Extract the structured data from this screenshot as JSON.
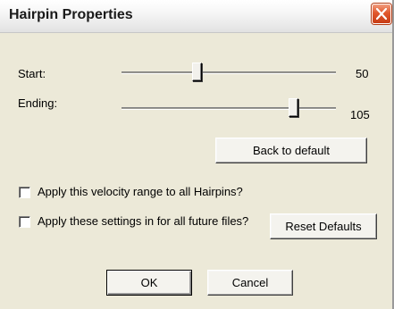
{
  "window": {
    "title": "Hairpin Properties"
  },
  "start": {
    "label": "Start:",
    "value": "50",
    "level": 0.35
  },
  "ending": {
    "label": "Ending:",
    "value": "105",
    "level": 0.8
  },
  "buttons": {
    "back_to_default": "Back to default",
    "reset_defaults": "Reset Defaults",
    "ok": "OK",
    "cancel": "Cancel"
  },
  "options": {
    "apply_all_hairpins": {
      "label": "Apply this velocity range to all Hairpins?",
      "checked": false
    },
    "apply_future_files": {
      "label": "Apply these settings in for all future files?",
      "checked": false
    }
  },
  "icons": {
    "close": "close-icon"
  },
  "colors": {
    "dialog_bg": "#ece9d8",
    "close_button": "#e1572c"
  }
}
